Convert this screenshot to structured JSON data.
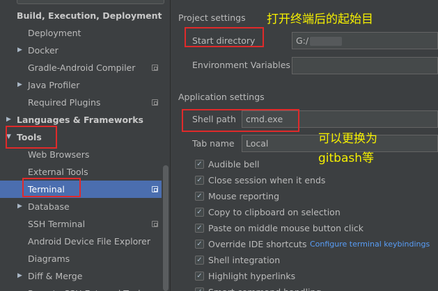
{
  "sidebar": {
    "items": [
      {
        "label": "Build, Execution, Deployment",
        "bold": true,
        "arrow": "",
        "indent": 24,
        "project": false
      },
      {
        "label": "Deployment",
        "bold": false,
        "arrow": "",
        "indent": 40,
        "project": false
      },
      {
        "label": "Docker",
        "bold": false,
        "arrow": "▶",
        "indent": 40,
        "project": false
      },
      {
        "label": "Gradle-Android Compiler",
        "bold": false,
        "arrow": "",
        "indent": 40,
        "project": true
      },
      {
        "label": "Java Profiler",
        "bold": false,
        "arrow": "▶",
        "indent": 40,
        "project": false
      },
      {
        "label": "Required Plugins",
        "bold": false,
        "arrow": "",
        "indent": 40,
        "project": true
      },
      {
        "label": "Languages & Frameworks",
        "bold": true,
        "arrow": "▶",
        "indent": 24,
        "project": false
      },
      {
        "label": "Tools",
        "bold": true,
        "arrow": "▼",
        "indent": 24,
        "project": false
      },
      {
        "label": "Web Browsers",
        "bold": false,
        "arrow": "",
        "indent": 40,
        "project": false
      },
      {
        "label": "External Tools",
        "bold": false,
        "arrow": "",
        "indent": 40,
        "project": false
      },
      {
        "label": "Terminal",
        "bold": false,
        "arrow": "",
        "indent": 40,
        "project": true,
        "selected": true
      },
      {
        "label": "Database",
        "bold": false,
        "arrow": "▶",
        "indent": 40,
        "project": false
      },
      {
        "label": "SSH Terminal",
        "bold": false,
        "arrow": "",
        "indent": 40,
        "project": true
      },
      {
        "label": "Android Device File Explorer",
        "bold": false,
        "arrow": "",
        "indent": 40,
        "project": false
      },
      {
        "label": "Diagrams",
        "bold": false,
        "arrow": "",
        "indent": 40,
        "project": false
      },
      {
        "label": "Diff & Merge",
        "bold": false,
        "arrow": "▶",
        "indent": 40,
        "project": false
      },
      {
        "label": "Remote SSH External Tools",
        "bold": false,
        "arrow": "",
        "indent": 40,
        "project": false
      }
    ]
  },
  "project_settings": {
    "title": "Project settings",
    "start_directory_label": "Start directory",
    "start_directory_value": "G:/",
    "env_vars_label": "Environment Variables",
    "env_vars_value": ""
  },
  "application_settings": {
    "title": "Application settings",
    "shell_path_label": "Shell path",
    "shell_path_value": "cmd.exe",
    "tab_name_label": "Tab name",
    "tab_name_value": "Local"
  },
  "options": [
    {
      "label": "Audible bell",
      "checked": true
    },
    {
      "label": "Close session when it ends",
      "checked": true
    },
    {
      "label": "Mouse reporting",
      "checked": true
    },
    {
      "label": "Copy to clipboard on selection",
      "checked": true
    },
    {
      "label": "Paste on middle mouse button click",
      "checked": true
    },
    {
      "label": "Override IDE shortcuts",
      "checked": true
    },
    {
      "label": "Shell integration",
      "checked": true
    },
    {
      "label": "Highlight hyperlinks",
      "checked": true
    },
    {
      "label": "Smart command handling",
      "checked": true
    }
  ],
  "configure_keybindings_link": "Configure terminal keybindings",
  "annotations": {
    "start_dir_note": "打开终端后的起始目",
    "shell_note_line1": "可以更换为",
    "shell_note_line2": "gitbash等"
  },
  "colors": {
    "background": "#3c3f41",
    "selection": "#4b6eaf",
    "link": "#589df6",
    "annotation_box": "#e02a2a",
    "annotation_text": "#f6f000"
  }
}
